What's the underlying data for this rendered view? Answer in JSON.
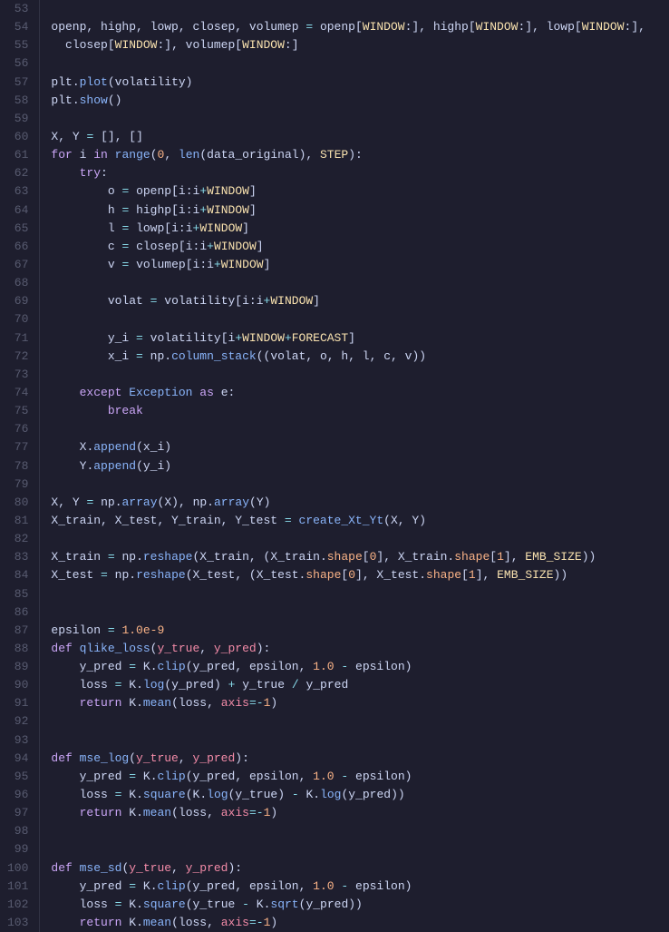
{
  "editor": {
    "background": "#1e1e2e",
    "lines": [
      {
        "num": 53,
        "content": ""
      },
      {
        "num": 54,
        "content": "openp, highp, lowp, closep, volumep = openp[WINDOW:], highp[WINDOW:], lowp[WINDOW:],"
      },
      {
        "num": 55,
        "content": "  closep[WINDOW:], volumep[WINDOW:]"
      },
      {
        "num": 56,
        "content": ""
      },
      {
        "num": 57,
        "content": "plt.plot(volatility)"
      },
      {
        "num": 58,
        "content": "plt.show()"
      },
      {
        "num": 59,
        "content": ""
      },
      {
        "num": 60,
        "content": "X, Y = [], []"
      },
      {
        "num": 61,
        "content": "for i in range(0, len(data_original), STEP):"
      },
      {
        "num": 62,
        "content": "    try:"
      },
      {
        "num": 63,
        "content": "        o = openp[i:i+WINDOW]"
      },
      {
        "num": 64,
        "content": "        h = highp[i:i+WINDOW]"
      },
      {
        "num": 65,
        "content": "        l = lowp[i:i+WINDOW]"
      },
      {
        "num": 66,
        "content": "        c = closep[i:i+WINDOW]"
      },
      {
        "num": 67,
        "content": "        v = volumep[i:i+WINDOW]"
      },
      {
        "num": 68,
        "content": ""
      },
      {
        "num": 69,
        "content": "        volat = volatility[i:i+WINDOW]"
      },
      {
        "num": 70,
        "content": ""
      },
      {
        "num": 71,
        "content": "        y_i = volatility[i+WINDOW+FORECAST]"
      },
      {
        "num": 72,
        "content": "        x_i = np.column_stack((volat, o, h, l, c, v))"
      },
      {
        "num": 73,
        "content": ""
      },
      {
        "num": 74,
        "content": "    except Exception as e:"
      },
      {
        "num": 75,
        "content": "        break"
      },
      {
        "num": 76,
        "content": ""
      },
      {
        "num": 77,
        "content": "    X.append(x_i)"
      },
      {
        "num": 78,
        "content": "    Y.append(y_i)"
      },
      {
        "num": 79,
        "content": ""
      },
      {
        "num": 80,
        "content": "X, Y = np.array(X), np.array(Y)"
      },
      {
        "num": 81,
        "content": "X_train, X_test, Y_train, Y_test = create_Xt_Yt(X, Y)"
      },
      {
        "num": 82,
        "content": ""
      },
      {
        "num": 83,
        "content": "X_train = np.reshape(X_train, (X_train.shape[0], X_train.shape[1], EMB_SIZE))"
      },
      {
        "num": 84,
        "content": "X_test = np.reshape(X_test, (X_test.shape[0], X_test.shape[1], EMB_SIZE))"
      },
      {
        "num": 85,
        "content": ""
      },
      {
        "num": 86,
        "content": ""
      },
      {
        "num": 87,
        "content": "epsilon = 1.0e-9"
      },
      {
        "num": 88,
        "content": "def qlike_loss(y_true, y_pred):"
      },
      {
        "num": 89,
        "content": "    y_pred = K.clip(y_pred, epsilon, 1.0 - epsilon)"
      },
      {
        "num": 90,
        "content": "    loss = K.log(y_pred) + y_true / y_pred"
      },
      {
        "num": 91,
        "content": "    return K.mean(loss, axis=-1)"
      },
      {
        "num": 92,
        "content": ""
      },
      {
        "num": 93,
        "content": ""
      },
      {
        "num": 94,
        "content": "def mse_log(y_true, y_pred):"
      },
      {
        "num": 95,
        "content": "    y_pred = K.clip(y_pred, epsilon, 1.0 - epsilon)"
      },
      {
        "num": 96,
        "content": "    loss = K.square(K.log(y_true) - K.log(y_pred))"
      },
      {
        "num": 97,
        "content": "    return K.mean(loss, axis=-1)"
      },
      {
        "num": 98,
        "content": ""
      },
      {
        "num": 99,
        "content": ""
      },
      {
        "num": 100,
        "content": "def mse_sd(y_true, y_pred):"
      },
      {
        "num": 101,
        "content": "    y_pred = K.clip(y_pred, epsilon, 1.0 - epsilon)"
      },
      {
        "num": 102,
        "content": "    loss = K.square(y_true - K.sqrt(y_pred))"
      },
      {
        "num": 103,
        "content": "    return K.mean(loss, axis=-1)"
      }
    ]
  }
}
